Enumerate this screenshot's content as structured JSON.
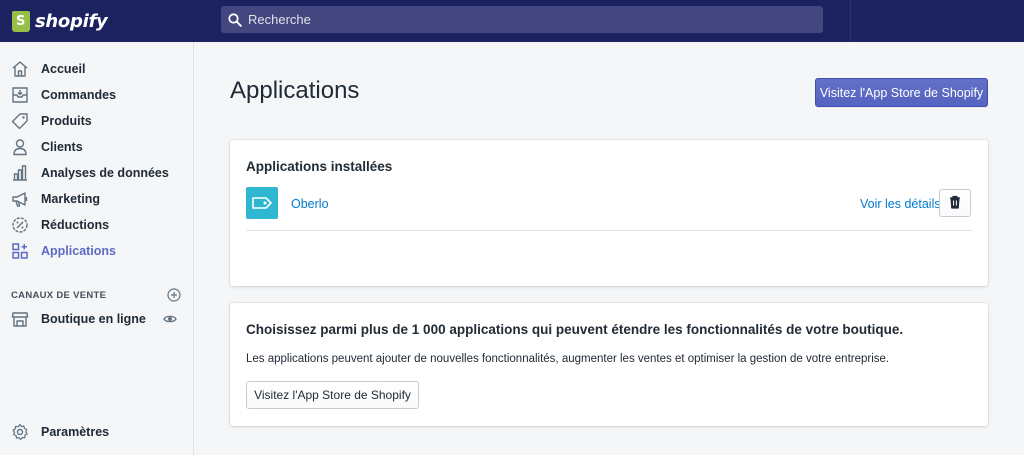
{
  "brand": {
    "name": "shopify",
    "color": "#95bf47"
  },
  "topbar": {
    "background": "#1c2260"
  },
  "search": {
    "placeholder": "Recherche",
    "icon": "search-icon"
  },
  "sidebar": {
    "items": [
      {
        "label": "Accueil",
        "icon": "home-icon"
      },
      {
        "label": "Commandes",
        "icon": "orders-icon"
      },
      {
        "label": "Produits",
        "icon": "tag-icon"
      },
      {
        "label": "Clients",
        "icon": "user-icon"
      },
      {
        "label": "Analyses de données",
        "icon": "bar-chart-icon"
      },
      {
        "label": "Marketing",
        "icon": "megaphone-icon"
      },
      {
        "label": "Réductions",
        "icon": "discount-icon"
      },
      {
        "label": "Applications",
        "icon": "apps-icon",
        "active": true
      }
    ],
    "section_title": "CANAUX DE VENTE",
    "channels": [
      {
        "label": "Boutique en ligne",
        "icon": "store-icon"
      }
    ],
    "settings_label": "Paramètres",
    "accent": "#5c6ac4"
  },
  "main": {
    "title": "Applications",
    "app_store_button": "Visitez l'App Store de Shopify",
    "installed": {
      "heading": "Applications installées",
      "apps": [
        {
          "name": "Oberlo",
          "details_link": "Voir les détails"
        }
      ]
    },
    "promo": {
      "heading": "Choisissez parmi plus de 1 000 applications qui peuvent étendre les fonctionnalités de votre boutique.",
      "text": "Les applications peuvent ajouter de nouvelles fonctionnalités, augmenter les ventes et optimiser la gestion de votre entreprise.",
      "button": "Visitez l'App Store de Shopify"
    }
  }
}
